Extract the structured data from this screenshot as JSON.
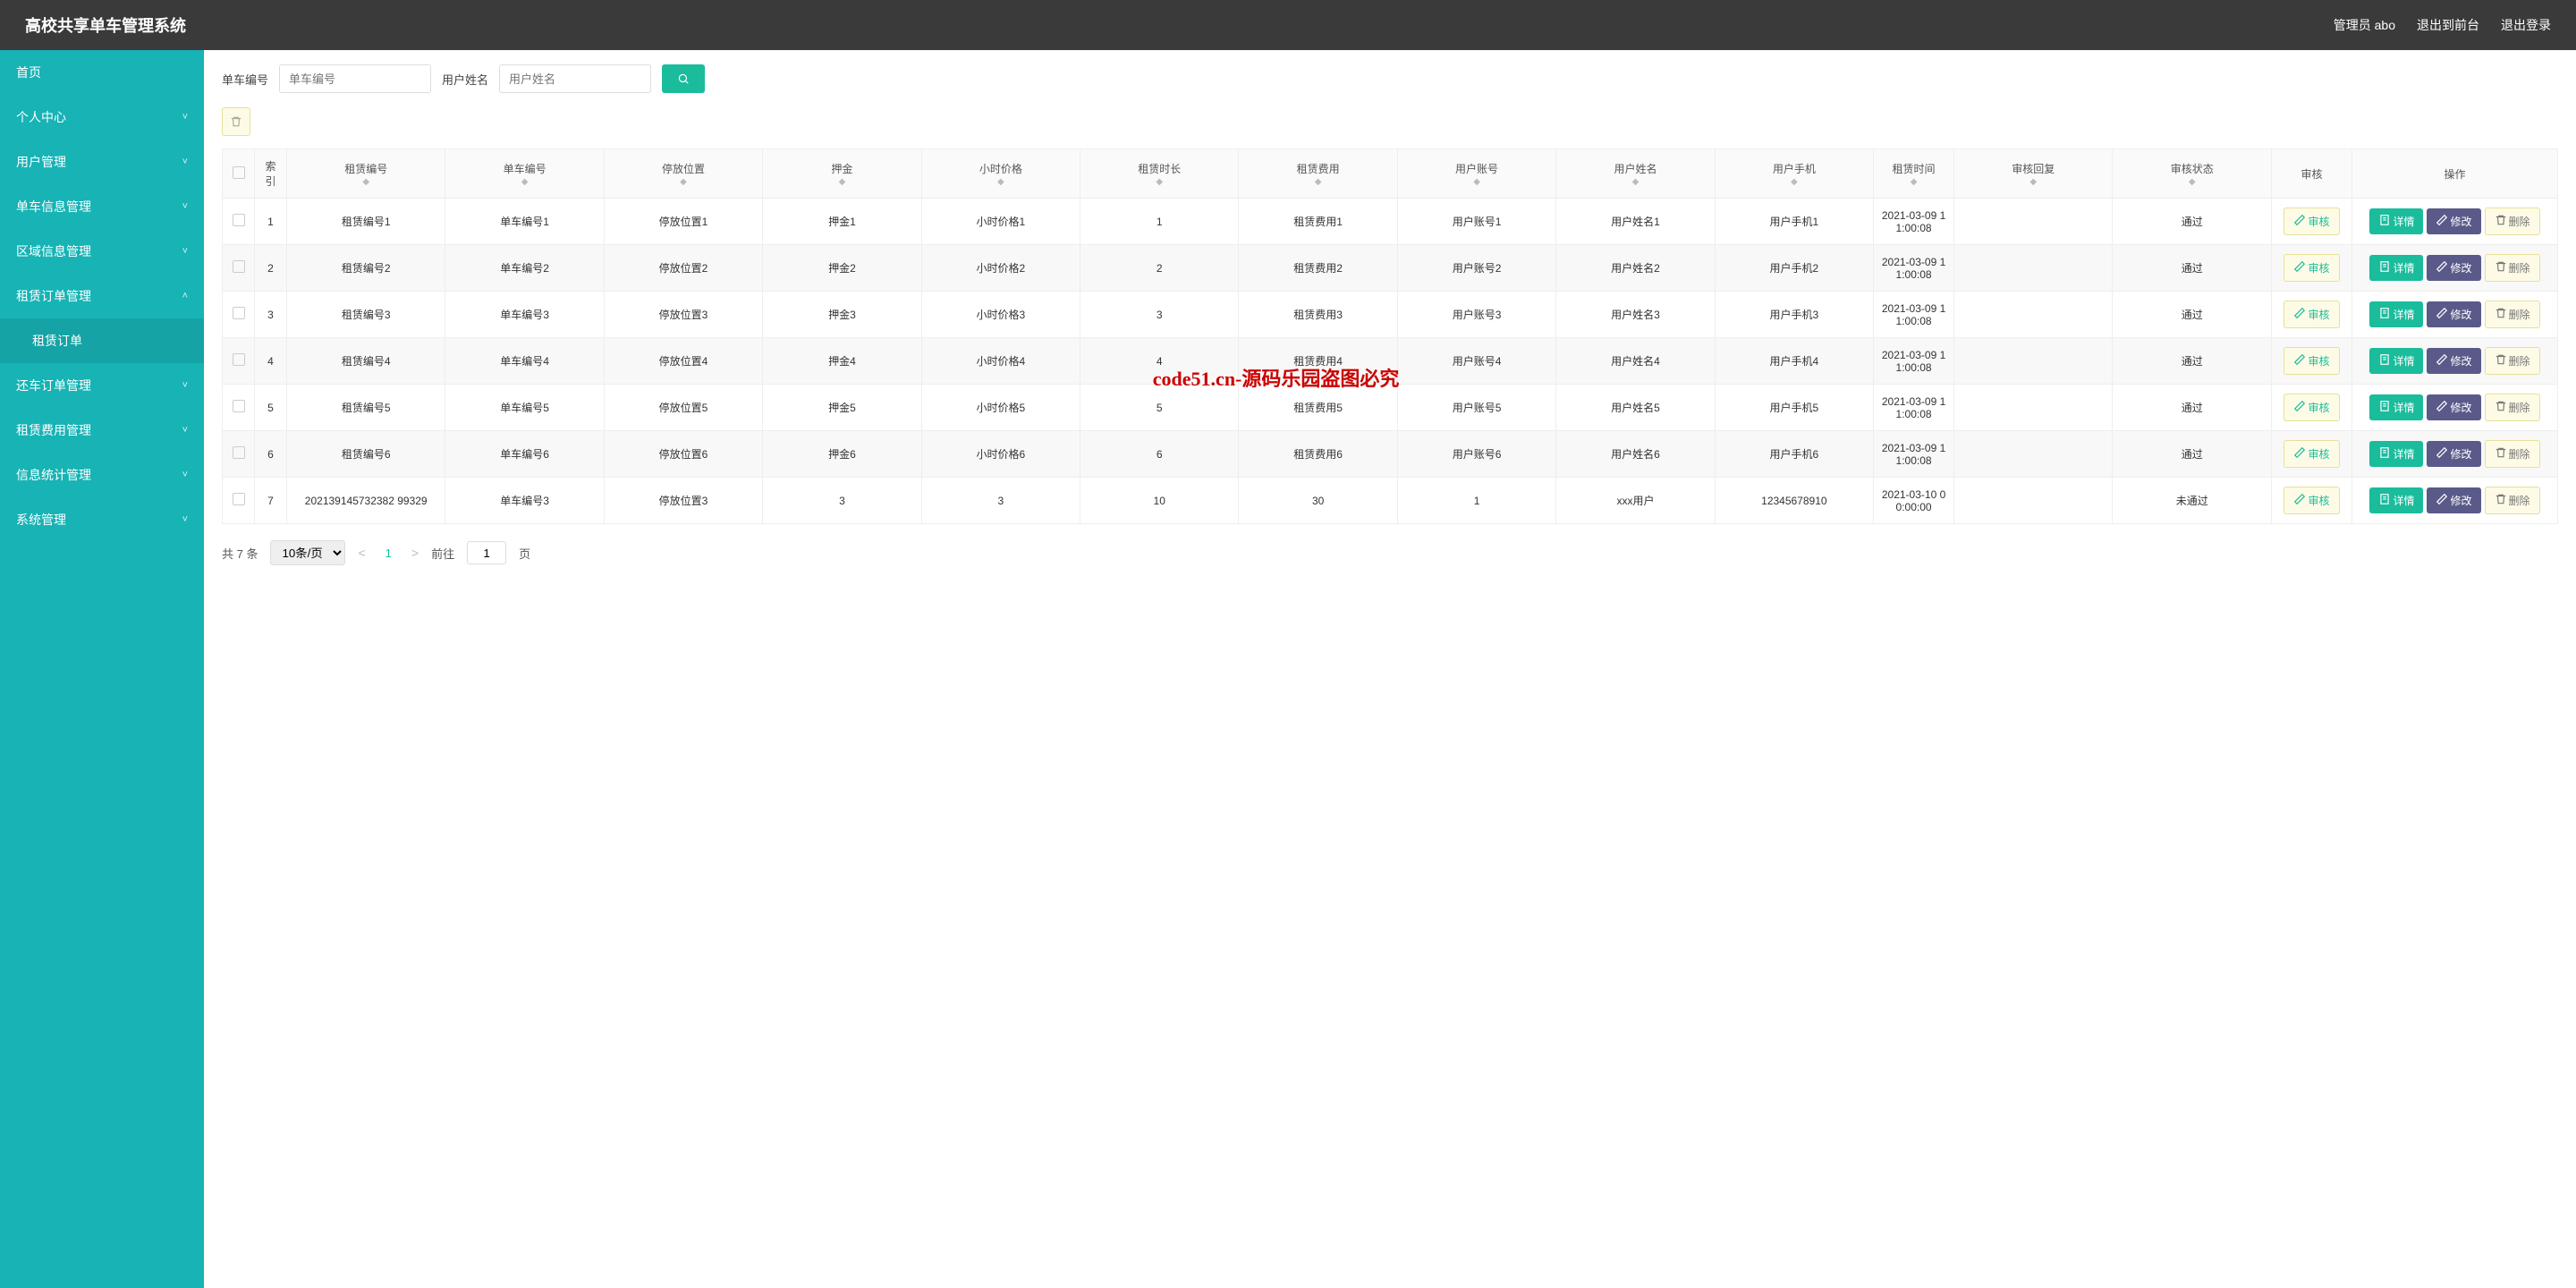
{
  "header": {
    "title": "高校共享单车管理系统",
    "userLabel": "管理员 abo",
    "toFront": "退出到前台",
    "logout": "退出登录"
  },
  "sidebar": {
    "items": [
      {
        "label": "首页",
        "expand": false
      },
      {
        "label": "个人中心",
        "expand": true,
        "chevron": "down"
      },
      {
        "label": "用户管理",
        "expand": true,
        "chevron": "down"
      },
      {
        "label": "单车信息管理",
        "expand": true,
        "chevron": "down"
      },
      {
        "label": "区域信息管理",
        "expand": true,
        "chevron": "down"
      },
      {
        "label": "租赁订单管理",
        "expand": true,
        "chevron": "up",
        "open": true
      },
      {
        "label": "租赁订单",
        "sub": true
      },
      {
        "label": "还车订单管理",
        "expand": true,
        "chevron": "down"
      },
      {
        "label": "租赁费用管理",
        "expand": true,
        "chevron": "down"
      },
      {
        "label": "信息统计管理",
        "expand": true,
        "chevron": "down"
      },
      {
        "label": "系统管理",
        "expand": true,
        "chevron": "down"
      }
    ]
  },
  "filters": {
    "bikeNoLabel": "单车编号",
    "bikeNoPh": "单车编号",
    "userNameLabel": "用户姓名",
    "userNamePh": "用户姓名"
  },
  "columns": [
    "",
    "索引",
    "租赁编号",
    "单车编号",
    "停放位置",
    "押金",
    "小时价格",
    "租赁时长",
    "租赁费用",
    "用户账号",
    "用户姓名",
    "用户手机",
    "租赁时间",
    "审核回复",
    "审核状态",
    "审核",
    "操作"
  ],
  "rows": [
    {
      "idx": "1",
      "rentNo": "租赁编号1",
      "bikeNo": "单车编号1",
      "loc": "停放位置1",
      "dep": "押金1",
      "price": "小时价格1",
      "dur": "1",
      "fee": "租赁费用1",
      "acct": "用户账号1",
      "uname": "用户姓名1",
      "phone": "用户手机1",
      "time": "2021-03-09 11:00:08",
      "reply": "",
      "status": "通过"
    },
    {
      "idx": "2",
      "rentNo": "租赁编号2",
      "bikeNo": "单车编号2",
      "loc": "停放位置2",
      "dep": "押金2",
      "price": "小时价格2",
      "dur": "2",
      "fee": "租赁费用2",
      "acct": "用户账号2",
      "uname": "用户姓名2",
      "phone": "用户手机2",
      "time": "2021-03-09 11:00:08",
      "reply": "",
      "status": "通过"
    },
    {
      "idx": "3",
      "rentNo": "租赁编号3",
      "bikeNo": "单车编号3",
      "loc": "停放位置3",
      "dep": "押金3",
      "price": "小时价格3",
      "dur": "3",
      "fee": "租赁费用3",
      "acct": "用户账号3",
      "uname": "用户姓名3",
      "phone": "用户手机3",
      "time": "2021-03-09 11:00:08",
      "reply": "",
      "status": "通过"
    },
    {
      "idx": "4",
      "rentNo": "租赁编号4",
      "bikeNo": "单车编号4",
      "loc": "停放位置4",
      "dep": "押金4",
      "price": "小时价格4",
      "dur": "4",
      "fee": "租赁费用4",
      "acct": "用户账号4",
      "uname": "用户姓名4",
      "phone": "用户手机4",
      "time": "2021-03-09 11:00:08",
      "reply": "",
      "status": "通过"
    },
    {
      "idx": "5",
      "rentNo": "租赁编号5",
      "bikeNo": "单车编号5",
      "loc": "停放位置5",
      "dep": "押金5",
      "price": "小时价格5",
      "dur": "5",
      "fee": "租赁费用5",
      "acct": "用户账号5",
      "uname": "用户姓名5",
      "phone": "用户手机5",
      "time": "2021-03-09 11:00:08",
      "reply": "",
      "status": "通过"
    },
    {
      "idx": "6",
      "rentNo": "租赁编号6",
      "bikeNo": "单车编号6",
      "loc": "停放位置6",
      "dep": "押金6",
      "price": "小时价格6",
      "dur": "6",
      "fee": "租赁费用6",
      "acct": "用户账号6",
      "uname": "用户姓名6",
      "phone": "用户手机6",
      "time": "2021-03-09 11:00:08",
      "reply": "",
      "status": "通过"
    },
    {
      "idx": "7",
      "rentNo": "202139145732382 99329",
      "bikeNo": "单车编号3",
      "loc": "停放位置3",
      "dep": "3",
      "price": "3",
      "dur": "10",
      "fee": "30",
      "acct": "1",
      "uname": "xxx用户",
      "phone": "12345678910",
      "time": "2021-03-10 00:00:00",
      "reply": "",
      "status": "未通过"
    }
  ],
  "actions": {
    "audit": "审核",
    "detail": "详情",
    "edit": "修改",
    "delete": "删除"
  },
  "pager": {
    "total": "共 7 条",
    "pageSize": "10条/页",
    "current": "1",
    "gotoLabel1": "前往",
    "gotoValue": "1",
    "gotoLabel2": "页"
  },
  "watermark": "code51.cn-源码乐园盗图必究"
}
